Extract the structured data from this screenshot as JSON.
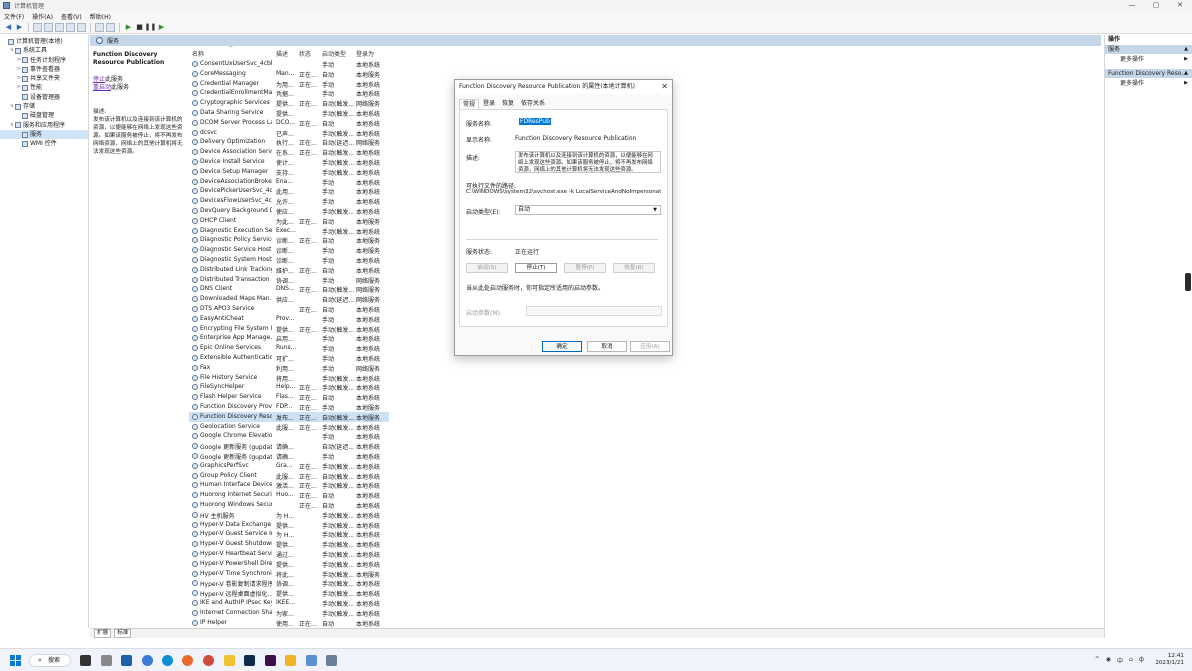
{
  "window": {
    "title": "计算机管理",
    "controls": [
      "—",
      "▢",
      "✕"
    ]
  },
  "menu": [
    "文件(F)",
    "操作(A)",
    "查看(V)",
    "帮助(H)"
  ],
  "tree": [
    {
      "label": "计算机管理(本地)",
      "indent": 0,
      "exp": "",
      "selected": false
    },
    {
      "label": "系统工具",
      "indent": 1,
      "exp": "v",
      "selected": false
    },
    {
      "label": "任务计划程序",
      "indent": 2,
      "exp": ">",
      "selected": false
    },
    {
      "label": "事件查看器",
      "indent": 2,
      "exp": ">",
      "selected": false
    },
    {
      "label": "共享文件夹",
      "indent": 2,
      "exp": ">",
      "selected": false
    },
    {
      "label": "性能",
      "indent": 2,
      "exp": ">",
      "selected": false
    },
    {
      "label": "设备管理器",
      "indent": 2,
      "exp": "",
      "selected": false
    },
    {
      "label": "存储",
      "indent": 1,
      "exp": "v",
      "selected": false
    },
    {
      "label": "磁盘管理",
      "indent": 2,
      "exp": "",
      "selected": false
    },
    {
      "label": "服务和应用程序",
      "indent": 1,
      "exp": "v",
      "selected": false
    },
    {
      "label": "服务",
      "indent": 2,
      "exp": "",
      "selected": true
    },
    {
      "label": "WMI 控件",
      "indent": 2,
      "exp": "",
      "selected": false
    }
  ],
  "pane": {
    "header": "服务",
    "selected_title": "Function Discovery Resource Publication",
    "link_stop": "停止",
    "link_stop_suffix": "此服务",
    "link_restart": "重启动",
    "link_restart_suffix": "此服务",
    "desc_label": "描述:",
    "desc_text": "发布该计算机以及连接到该计算机的资源，以便能够在网络上发现这些资源。如果该服务被停止，将不再发布网络资源，网络上的其他计算机将无法发现这些资源。"
  },
  "columns": {
    "name": "名称",
    "desc": "描述",
    "status": "状态",
    "start": "启动类型",
    "logon": "登录为"
  },
  "services": [
    [
      "ConsentUxUserSvc_4cbb1",
      "",
      "",
      "手动",
      "本地系统"
    ],
    [
      "CoreMessaging",
      "Man...",
      "正在...",
      "自动",
      "本地服务"
    ],
    [
      "Credential Manager",
      "为用...",
      "正在...",
      "手动",
      "本地系统"
    ],
    [
      "CredentialEnrollmentMan...",
      "凭据...",
      "",
      "手动",
      "本地系统"
    ],
    [
      "Cryptographic Services",
      "提供...",
      "正在...",
      "自动(触发...",
      "网络服务"
    ],
    [
      "Data Sharing Service",
      "提供...",
      "",
      "手动(触发...",
      "本地系统"
    ],
    [
      "DCOM Server Process La...",
      "DCO...",
      "正在...",
      "自动",
      "本地系统"
    ],
    [
      "dcsvc",
      "已声...",
      "",
      "手动(触发...",
      "本地系统"
    ],
    [
      "Delivery Optimization",
      "执行...",
      "正在...",
      "自动(延迟...",
      "网络服务"
    ],
    [
      "Device Association Service",
      "在系...",
      "正在...",
      "自动(触发...",
      "本地系统"
    ],
    [
      "Device Install Service",
      "使计...",
      "",
      "手动(触发...",
      "本地系统"
    ],
    [
      "Device Setup Manager",
      "支持...",
      "",
      "手动(触发...",
      "本地系统"
    ],
    [
      "DeviceAssociationBroker...",
      "Ena...",
      "",
      "手动",
      "本地系统"
    ],
    [
      "DevicePickerUserSvc_4cb...",
      "此用...",
      "",
      "手动",
      "本地系统"
    ],
    [
      "DevicesFlowUserSvc_4cb...",
      "允许...",
      "",
      "手动",
      "本地系统"
    ],
    [
      "DevQuery Background D...",
      "使应...",
      "",
      "手动(触发...",
      "本地系统"
    ],
    [
      "DHCP Client",
      "为此...",
      "正在...",
      "自动",
      "本地服务"
    ],
    [
      "Diagnostic Execution Ser...",
      "Exec...",
      "",
      "手动(触发...",
      "本地系统"
    ],
    [
      "Diagnostic Policy Service",
      "诊断...",
      "正在...",
      "自动",
      "本地服务"
    ],
    [
      "Diagnostic Service Host",
      "诊断...",
      "",
      "手动",
      "本地服务"
    ],
    [
      "Diagnostic System Host",
      "诊断...",
      "",
      "手动",
      "本地系统"
    ],
    [
      "Distributed Link Tracking...",
      "维护...",
      "正在...",
      "自动",
      "本地系统"
    ],
    [
      "Distributed Transaction C...",
      "协调...",
      "",
      "手动",
      "网络服务"
    ],
    [
      "DNS Client",
      "DNS...",
      "正在...",
      "自动(触发...",
      "网络服务"
    ],
    [
      "Downloaded Maps Man...",
      "供应...",
      "",
      "自动(延迟...",
      "网络服务"
    ],
    [
      "DTS APO3 Service",
      "",
      "正在...",
      "自动",
      "本地系统"
    ],
    [
      "EasyAntiCheat",
      "Prov...",
      "",
      "手动",
      "本地系统"
    ],
    [
      "Encrypting File System (E...",
      "提供...",
      "正在...",
      "手动(触发...",
      "本地系统"
    ],
    [
      "Enterprise App Manage...",
      "启用...",
      "",
      "手动",
      "本地系统"
    ],
    [
      "Epic Online Services",
      "Runs...",
      "",
      "手动",
      "本地系统"
    ],
    [
      "Extensible Authentication...",
      "可扩...",
      "",
      "手动",
      "本地系统"
    ],
    [
      "Fax",
      "利用...",
      "",
      "手动",
      "网络服务"
    ],
    [
      "File History Service",
      "将用...",
      "",
      "手动(触发...",
      "本地系统"
    ],
    [
      "FileSyncHelper",
      "Help...",
      "正在...",
      "手动(触发...",
      "本地系统"
    ],
    [
      "Flash Helper Service",
      "Flas...",
      "正在...",
      "自动",
      "本地系统"
    ],
    [
      "Function Discovery Provi...",
      "FDP...",
      "正在...",
      "手动",
      "本地服务"
    ],
    [
      "Function Discovery Reso...",
      "发布...",
      "正在...",
      "自动(触发...",
      "本地服务"
    ],
    [
      "Geolocation Service",
      "此服...",
      "正在...",
      "手动(触发...",
      "本地系统"
    ],
    [
      "Google Chrome Elevatio...",
      "",
      "",
      "手动",
      "本地系统"
    ],
    [
      "Google 更新服务 (gupdate)",
      "请确...",
      "",
      "自动(延迟...",
      "本地系统"
    ],
    [
      "Google 更新服务 (gupdat...",
      "请确...",
      "",
      "手动",
      "本地系统"
    ],
    [
      "GraphicsPerfSvc",
      "Gra...",
      "正在...",
      "手动(触发...",
      "本地系统"
    ],
    [
      "Group Policy Client",
      "此服...",
      "正在...",
      "自动(触发...",
      "本地系统"
    ],
    [
      "Human Interface Device ...",
      "激活...",
      "正在...",
      "手动(触发...",
      "本地系统"
    ],
    [
      "Huorong Internet Securit...",
      "Huo...",
      "正在...",
      "自动",
      "本地系统"
    ],
    [
      "Huorong Windows Secur...",
      "",
      "正在...",
      "自动",
      "本地系统"
    ],
    [
      "HV 主机服务",
      "为 H...",
      "",
      "手动(触发...",
      "本地系统"
    ],
    [
      "Hyper-V Data Exchange ...",
      "提供...",
      "",
      "手动(触发...",
      "本地系统"
    ],
    [
      "Hyper-V Guest Service In...",
      "为 H...",
      "",
      "手动(触发...",
      "本地系统"
    ],
    [
      "Hyper-V Guest Shutdown...",
      "提供...",
      "",
      "手动(触发...",
      "本地系统"
    ],
    [
      "Hyper-V Heartbeat Service",
      "通过...",
      "",
      "手动(触发...",
      "本地系统"
    ],
    [
      "Hyper-V PowerShell Dire...",
      "提供...",
      "",
      "手动(触发...",
      "本地系统"
    ],
    [
      "Hyper-V Time Synchroniz...",
      "将此...",
      "",
      "手动(触发...",
      "本地服务"
    ],
    [
      "Hyper-V 卷影复制请求程序",
      "协调...",
      "",
      "手动(触发...",
      "本地系统"
    ],
    [
      "Hyper-V 远程桌面虚拟化...",
      "提供...",
      "",
      "手动(触发...",
      "本地系统"
    ],
    [
      "IKE and AuthIP IPsec Key...",
      "IKEE...",
      "",
      "手动(触发...",
      "本地系统"
    ],
    [
      "Internet Connection Shari...",
      "为家...",
      "",
      "手动(触发...",
      "本地系统"
    ],
    [
      "IP Helper",
      "使用...",
      "正在...",
      "自动",
      "本地系统"
    ]
  ],
  "selected_index": 36,
  "bottom_tabs": [
    "扩展",
    "标准"
  ],
  "actions": {
    "title": "操作",
    "sections": [
      {
        "label": "服务",
        "items": [
          "更多操作"
        ]
      },
      {
        "label": "Function Discovery Reso...",
        "items": [
          "更多操作"
        ]
      }
    ]
  },
  "dialog": {
    "title": "Function Discovery Resource Publication 的属性(本地计算机)",
    "tabs": [
      "常规",
      "登录",
      "恢复",
      "依存关系"
    ],
    "service_name_label": "服务名称:",
    "service_name": "FDResPub",
    "display_name_label": "显示名称:",
    "display_name": "Function Discovery Resource Publication",
    "description_label": "描述:",
    "description": "发布该计算机以及连接到该计算机的资源，以便能够在网络上发现这些资源。如果该服务被停止，将不再发布网络资源，网络上的其他计算机将无法发现这些资源。",
    "path_label": "可执行文件的路径:",
    "path": "C:\\WINDOWS\\system32\\svchost.exe -k LocalServiceAndNoImpersonation -p",
    "startup_label": "启动类型(E):",
    "startup_value": "自动",
    "status_label": "服务状态:",
    "status_value": "正在运行",
    "btn_start": "启动(S)",
    "btn_stop": "停止(T)",
    "btn_pause": "暂停(P)",
    "btn_resume": "恢复(R)",
    "hint": "当从此处启动服务时，你可指定所适用的启动参数。",
    "params_label": "启动参数(M):",
    "ok": "确定",
    "cancel": "取消",
    "apply": "应用(A)"
  },
  "taskbar": {
    "search": "搜索",
    "tray": [
      "^",
      "◉",
      "中",
      "⌂",
      "ф"
    ],
    "time": "12:41",
    "date": "2023/1/21"
  },
  "colors": {
    "header_bg": "#c7d7ea",
    "selection": "#cde1f5",
    "link": "#6b2fa8",
    "accent": "#0078d7"
  }
}
